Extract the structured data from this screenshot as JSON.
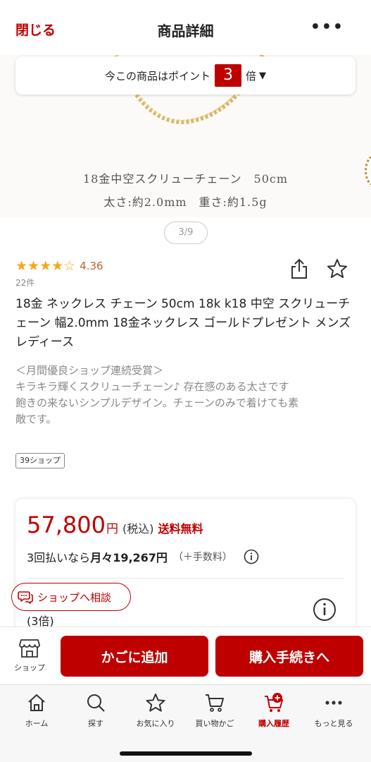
{
  "header": {
    "close_label": "閉じる",
    "title": "商品詳細",
    "more_label": "•••"
  },
  "point_banner": {
    "prefix": "今この商品はポイント",
    "multiplier": "3",
    "suffix": "倍",
    "caret": "▼"
  },
  "image": {
    "caption_line1": "18金中空スクリューチェーン　50cm",
    "caption_line2": "太さ:約2.0mm　重さ:約1.5g",
    "counter": "3/9"
  },
  "rating": {
    "stars_display": "★★★★☆",
    "value": "4.36",
    "review_count": "22件",
    "stars_value": 4.36
  },
  "product": {
    "name": "18金 ネックレス チェーン 50cm 18k k18 中空 スクリューチェーン 幅2.0mm 18金ネックレス ゴールドプレゼント メンズ レディース",
    "description_lines": [
      "＜月間優良ショップ連続受賞＞",
      "キラキラ輝くスクリューチェーン♪ 存在感のある太さです",
      "飽きの来ないシンプルデザイン。チェーンのみで着けても素",
      "敵です。"
    ],
    "shop_tag": "39ショップ"
  },
  "price": {
    "amount": "57,800",
    "yen": "円",
    "tax": "(税込)",
    "shipping": "送料無料",
    "installment_prefix": "3回払いなら",
    "installment_amount": "月々19,267円",
    "installment_fee": "（＋手数料）",
    "point_times": "(3倍)"
  },
  "consult": {
    "label": "ショップへ相談"
  },
  "actions": {
    "shop_label": "ショップ",
    "add_to_cart": "かごに追加",
    "checkout": "購入手続きへ"
  },
  "tabs": [
    {
      "label": "ホーム",
      "icon": "home-icon"
    },
    {
      "label": "探す",
      "icon": "search-icon"
    },
    {
      "label": "お気に入り",
      "icon": "star-icon"
    },
    {
      "label": "買い物かご",
      "icon": "cart-icon"
    },
    {
      "label": "購入履歴",
      "icon": "purchase-history-icon"
    },
    {
      "label": "もっと見る",
      "icon": "more-icon"
    }
  ],
  "colors": {
    "accent": "#bf0000",
    "star": "#f3a81b",
    "rating_text": "#c4632a",
    "muted": "#888888"
  }
}
